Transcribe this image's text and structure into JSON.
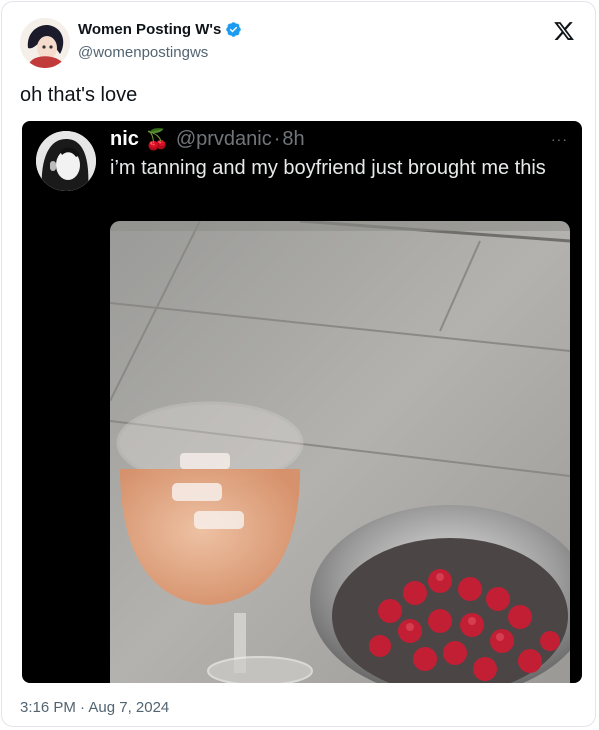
{
  "author": {
    "display_name": "Women Posting W's",
    "handle": "@womenpostingws",
    "verified": true
  },
  "tweet": {
    "text": "oh that's love",
    "timestamp": "3:16 PM · Aug 7, 2024"
  },
  "quoted": {
    "display_name": "nic",
    "emoji": "🍒",
    "handle": "@prvdanic",
    "separator": "·",
    "time_ago": "8h",
    "text": "i’m tanning and my boyfriend just brought me this",
    "more_label": "···"
  },
  "colors": {
    "verified_blue": "#1d9bf0",
    "quote_bg": "#000000",
    "secondary_text": "#536471"
  }
}
